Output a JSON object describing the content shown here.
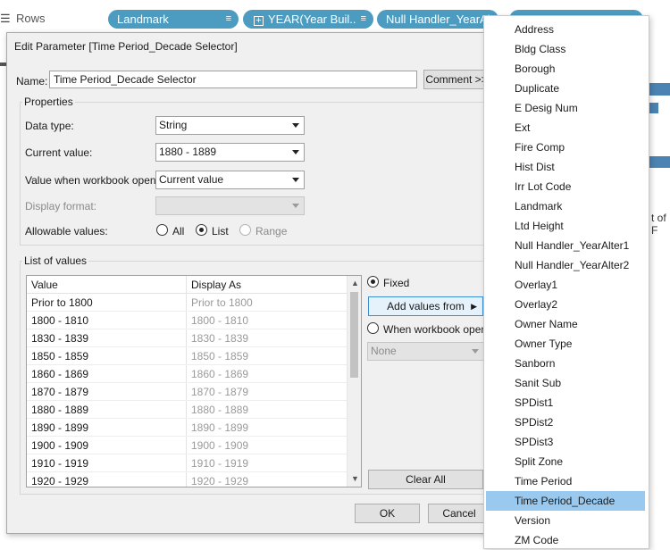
{
  "shelf": {
    "rows_label": "Rows",
    "pills": [
      "Landmark",
      "YEAR(Year Buil..",
      "Null Handler_YearAlt"
    ]
  },
  "background": {
    "cut_text": "t of F"
  },
  "dialog": {
    "title": "Edit Parameter [Time Period_Decade Selector]",
    "name_label": "Name:",
    "name_value": "Time Period_Decade Selector",
    "comment_button": "Comment >>",
    "properties_label": "Properties",
    "data_type_label": "Data type:",
    "data_type_value": "String",
    "current_value_label": "Current value:",
    "current_value_value": "1880 - 1889",
    "workbook_opens_label": "Value when workbook opens:",
    "workbook_opens_value": "Current value",
    "display_format_label": "Display format:",
    "display_format_value": "",
    "allowable_label": "Allowable values:",
    "allowable_options": [
      "All",
      "List",
      "Range"
    ],
    "allowable_selected": "List",
    "list_label": "List of values",
    "columns": [
      "Value",
      "Display As"
    ],
    "rows": [
      [
        "Prior to 1800",
        "Prior to 1800"
      ],
      [
        "1800 - 1810",
        "1800 - 1810"
      ],
      [
        "1830 - 1839",
        "1830 - 1839"
      ],
      [
        "1850 - 1859",
        "1850 - 1859"
      ],
      [
        "1860 - 1869",
        "1860 - 1869"
      ],
      [
        "1870 - 1879",
        "1870 - 1879"
      ],
      [
        "1880 - 1889",
        "1880 - 1889"
      ],
      [
        "1890 - 1899",
        "1890 - 1899"
      ],
      [
        "1900 - 1909",
        "1900 - 1909"
      ],
      [
        "1910 - 1919",
        "1910 - 1919"
      ],
      [
        "1920 - 1929",
        "1920 - 1929"
      ]
    ],
    "fixed_label": "Fixed",
    "add_values_button": "Add values from",
    "when_opens_label": "When workbook opens",
    "none_value": "None",
    "clear_all_button": "Clear All",
    "ok_button": "OK",
    "cancel_button": "Cancel"
  },
  "menu": {
    "items": [
      "Address",
      "Bldg Class",
      "Borough",
      "Duplicate",
      "E Desig Num",
      "Ext",
      "Fire Comp",
      "Hist Dist",
      "Irr Lot Code",
      "Landmark",
      "Ltd Height",
      "Null Handler_YearAlter1",
      "Null Handler_YearAlter2",
      "Overlay1",
      "Overlay2",
      "Owner Name",
      "Owner Type",
      "Sanborn",
      "Sanit Sub",
      "SPDist1",
      "SPDist2",
      "SPDist3",
      "Split Zone",
      "Time Period",
      "Time Period_Decade",
      "Version",
      "ZM Code"
    ],
    "selected": "Time Period_Decade"
  },
  "colors": {
    "pill": "#4b9cc0",
    "menu_highlight": "#99c9ef",
    "dialog_bg": "#f0f0f0"
  }
}
